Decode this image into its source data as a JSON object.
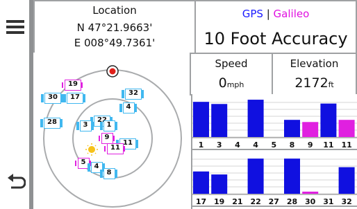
{
  "location": {
    "title": "Location",
    "lat": "N 47°21.9663'",
    "lon": "E 008°49.7361'"
  },
  "constellations": {
    "gps": "GPS",
    "sep": "|",
    "galileo": "Galileo",
    "gps_color": "#1a1aff",
    "galileo_color": "#e010e0"
  },
  "accuracy": "10 Foot Accuracy",
  "speed": {
    "title": "Speed",
    "value": "0",
    "unit": "mph"
  },
  "elevation": {
    "title": "Elevation",
    "value": "2172",
    "unit": "ft"
  },
  "colors": {
    "gps_bar": "#1010e0",
    "galileo_bar": "#e020e0",
    "sat_gps": "#40b8f0",
    "sat_galileo": "#e020e0",
    "rule": "#8f9193"
  },
  "sky_satellites": [
    {
      "id": "19",
      "sys": "galileo"
    },
    {
      "id": "32",
      "sys": "gps"
    },
    {
      "id": "30",
      "sys": "gps"
    },
    {
      "id": "17",
      "sys": "gps"
    },
    {
      "id": "4",
      "sys": "gps"
    },
    {
      "id": "28",
      "sys": "gps"
    },
    {
      "id": "22",
      "sys": "gps"
    },
    {
      "id": "3",
      "sys": "gps"
    },
    {
      "id": "1",
      "sys": "gps"
    },
    {
      "id": "9",
      "sys": "galileo"
    },
    {
      "id": "11",
      "sys": "gps"
    },
    {
      "id": "11",
      "sys": "galileo"
    },
    {
      "id": "5",
      "sys": "galileo"
    },
    {
      "id": "4",
      "sys": "gps"
    },
    {
      "id": "8",
      "sys": "gps"
    }
  ],
  "signal_rows": [
    {
      "bars": [
        {
          "id": "1",
          "sys": "gps",
          "level": 0.82
        },
        {
          "id": "3",
          "sys": "gps",
          "level": 0.77
        },
        {
          "id": "4",
          "sys": "gps",
          "level": 0
        },
        {
          "id": "4",
          "sys": "gps",
          "level": 0.87
        },
        {
          "id": "5",
          "sys": "gps",
          "level": 0
        },
        {
          "id": "8",
          "sys": "gps",
          "level": 0.4
        },
        {
          "id": "9",
          "sys": "galileo",
          "level": 0.35
        },
        {
          "id": "11",
          "sys": "gps",
          "level": 0.78
        },
        {
          "id": "11",
          "sys": "galileo",
          "level": 0.4
        }
      ]
    },
    {
      "bars": [
        {
          "id": "17",
          "sys": "gps",
          "level": 0.52
        },
        {
          "id": "19",
          "sys": "gps",
          "level": 0.45
        },
        {
          "id": "21",
          "sys": "gps",
          "level": 0
        },
        {
          "id": "22",
          "sys": "gps",
          "level": 0.82
        },
        {
          "id": "27",
          "sys": "gps",
          "level": 0
        },
        {
          "id": "28",
          "sys": "gps",
          "level": 0.82
        },
        {
          "id": "30",
          "sys": "galileo",
          "level": 0.05
        },
        {
          "id": "31",
          "sys": "gps",
          "level": 0
        },
        {
          "id": "32",
          "sys": "gps",
          "level": 0.62
        }
      ]
    }
  ]
}
